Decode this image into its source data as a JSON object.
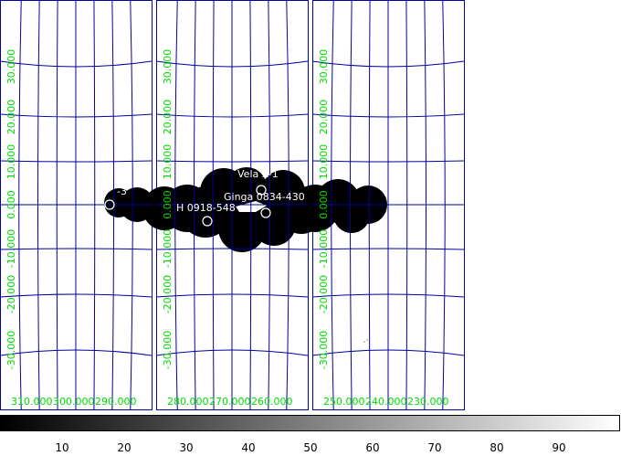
{
  "panels": [
    {
      "lon_labels": [
        "310.000",
        "300.000",
        "290.000"
      ],
      "lat_labels": [
        "30.000",
        "20.000",
        "10.000",
        "0.000",
        "-10.000",
        "-20.000",
        "-30.000"
      ]
    },
    {
      "lon_labels": [
        "280.000",
        "270.000",
        "260.000"
      ],
      "lat_labels": [
        "30.000",
        "20.000",
        "10.000",
        "0.000",
        "-10.000",
        "-20.000",
        "-30.000"
      ]
    },
    {
      "lon_labels": [
        "250.000",
        "240.000",
        "230.000"
      ],
      "lat_labels": [
        "30.000",
        "20.000",
        "10.000",
        "0.000",
        "-10.000",
        "-20.000",
        "-30.000"
      ]
    }
  ],
  "sources": [
    {
      "label": "Vela X-1"
    },
    {
      "label": "Ginga 0834-430"
    },
    {
      "label": "H 0918-548"
    },
    {
      "label": "-3"
    }
  ],
  "colorbar": {
    "ticks": [
      "10",
      "20",
      "30",
      "40",
      "50",
      "60",
      "70",
      "80",
      "90"
    ]
  },
  "colors": {
    "grid": "#0000a0",
    "coord_labels": "#00dd00",
    "source_labels": "#ffffff",
    "exposure": "#000000"
  }
}
